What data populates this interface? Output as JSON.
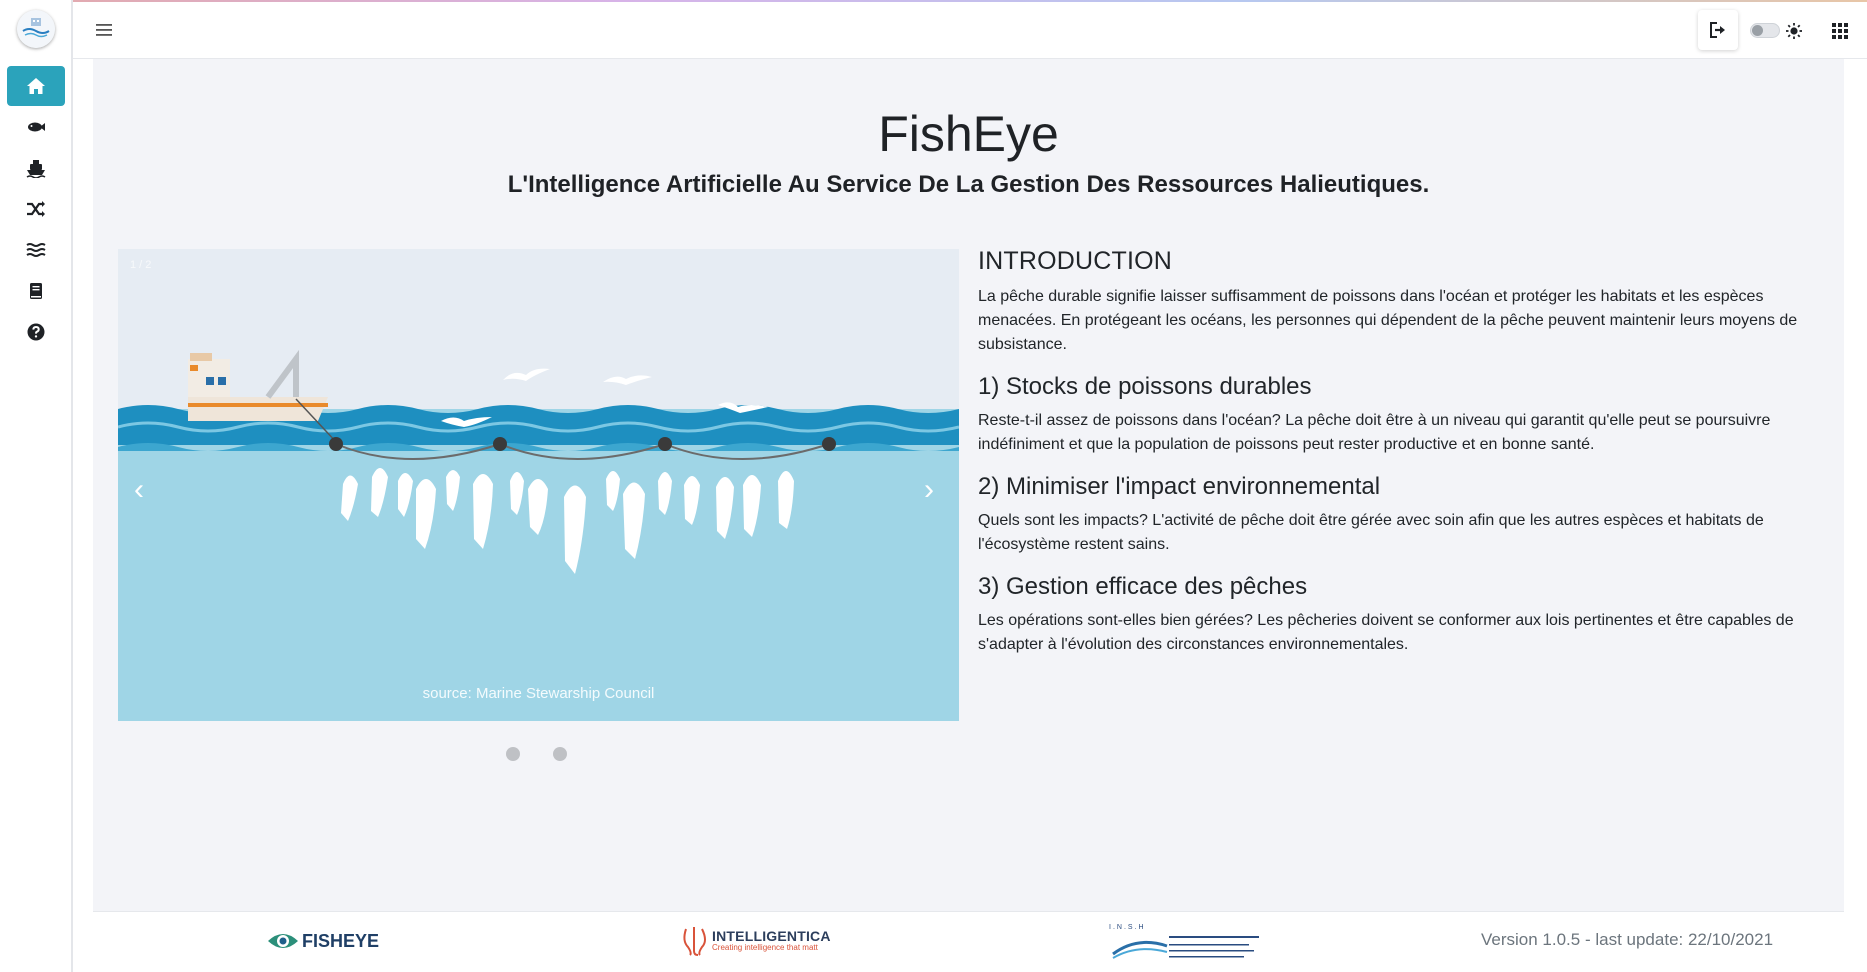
{
  "page": {
    "title": "FishEye",
    "subtitle": "L'Intelligence Artificielle Au Service De La Gestion Des Ressources Halieutiques."
  },
  "sidebar": {
    "items": [
      {
        "icon": "home-icon",
        "active": true
      },
      {
        "icon": "fish-icon",
        "active": false
      },
      {
        "icon": "ship-icon",
        "active": false
      },
      {
        "icon": "shuffle-icon",
        "active": false
      },
      {
        "icon": "water-icon",
        "active": false
      },
      {
        "icon": "book-icon",
        "active": false
      },
      {
        "icon": "question-circle-icon",
        "active": false
      }
    ]
  },
  "topbar": {
    "icons": [
      "menu-icon",
      "logout-icon",
      "theme-toggle",
      "sun-icon",
      "apps-grid-icon"
    ],
    "theme_dark_enabled": false
  },
  "carousel": {
    "counter": "1 / 2",
    "caption": "source: Marine Stewarship Council",
    "prev": "‹",
    "next": "›",
    "slide_count": 2,
    "active_index": 0
  },
  "intro": {
    "heading": "INTRODUCTION",
    "text": "La pêche durable signifie laisser suffisamment de poissons dans l'océan et protéger les habitats et les espèces menacées. En protégeant les océans, les personnes qui dépendent de la pêche peuvent maintenir leurs moyens de subsistance.",
    "sections": [
      {
        "title": "1) Stocks de poissons durables",
        "text": "Reste-t-il assez de poissons dans l'océan? La pêche doit être à un niveau qui garantit qu'elle peut se poursuivre indéfiniment et que la population de poissons peut rester productive et en bonne santé."
      },
      {
        "title": "2) Minimiser l'impact environnemental",
        "text": "Quels sont les impacts? L'activité de pêche doit être gérée avec soin afin que les autres espèces et habitats de l'écosystème restent sains."
      },
      {
        "title": "3) Gestion efficace des pêches",
        "text": "Les opérations sont-elles bien gérées? Les pêcheries doivent se conformer aux lois pertinentes et être capables de s'adapter à l'évolution des circonstances environnementales."
      }
    ]
  },
  "footer": {
    "fisheye_logo": "FISHEYE",
    "intelligentica_logo": "INTELLIGENTICA",
    "intelligentica_tagline": "Creating intelligence that matt",
    "insh_logo": "I.N.S.H",
    "version": "Version 1.0.5 - last update: 22/10/2021"
  },
  "colors": {
    "accent": "#2ba3bb",
    "sea_light": "#9fd5e6",
    "sea_band": "#1e8fc0",
    "sky": "#e6ecf3",
    "main_bg": "#f3f4f8"
  }
}
